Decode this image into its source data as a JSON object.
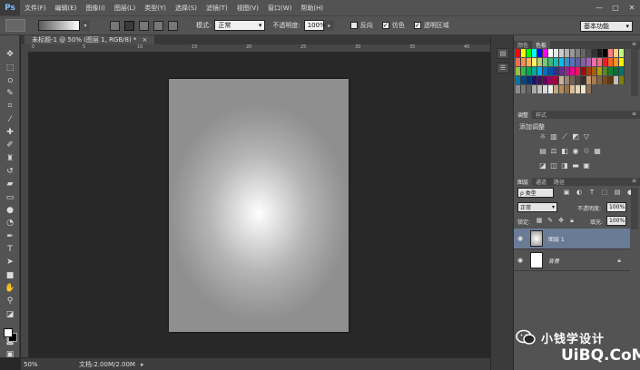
{
  "app": {
    "logo": "Ps",
    "menu": [
      "文件(F)",
      "编辑(E)",
      "图像(I)",
      "图层(L)",
      "类型(Y)",
      "选择(S)",
      "滤镜(T)",
      "视图(V)",
      "窗口(W)",
      "帮助(H)"
    ],
    "window_controls": [
      "—",
      "□",
      "✕"
    ]
  },
  "options": {
    "mode_label": "模式:",
    "mode_value": "正常",
    "opacity_label": "不透明度:",
    "opacity_value": "100%",
    "reverse_label": "反向",
    "dither_label": "仿色",
    "transparency_label": "透明区域",
    "workspace": "基本功能"
  },
  "document": {
    "tab_title": "未标题-1 @ 50% (图层 1, RGB/8) *",
    "ruler_ticks": [
      "0",
      "5",
      "10",
      "15",
      "20",
      "25",
      "30",
      "35",
      "40"
    ],
    "zoom": "50%",
    "doc_info": "文档:2.00M/2.00M"
  },
  "panels": {
    "swatch_tabs": [
      "颜色",
      "色板"
    ],
    "adjust_tabs": [
      "调整",
      "样式"
    ],
    "adjust_title": "添加调整",
    "layer_tabs": [
      "图层",
      "通道",
      "路径"
    ],
    "filter_type": "ρ 类型",
    "blend_mode": "正常",
    "opacity_label": "不透明度:",
    "opacity_value": "100%",
    "lock_label": "锁定:",
    "fill_label": "填充:",
    "fill_value": "100%",
    "layers": [
      {
        "name": "图层 1",
        "selected": true
      },
      {
        "name": "背景",
        "selected": false
      }
    ]
  },
  "watermark": {
    "line1": "小钱学设计",
    "line2": "UiBQ.CoM"
  },
  "colors": {
    "accent_selected_layer": "#6a7b96",
    "chrome": "#535353",
    "canvas_bg": "#282828"
  }
}
